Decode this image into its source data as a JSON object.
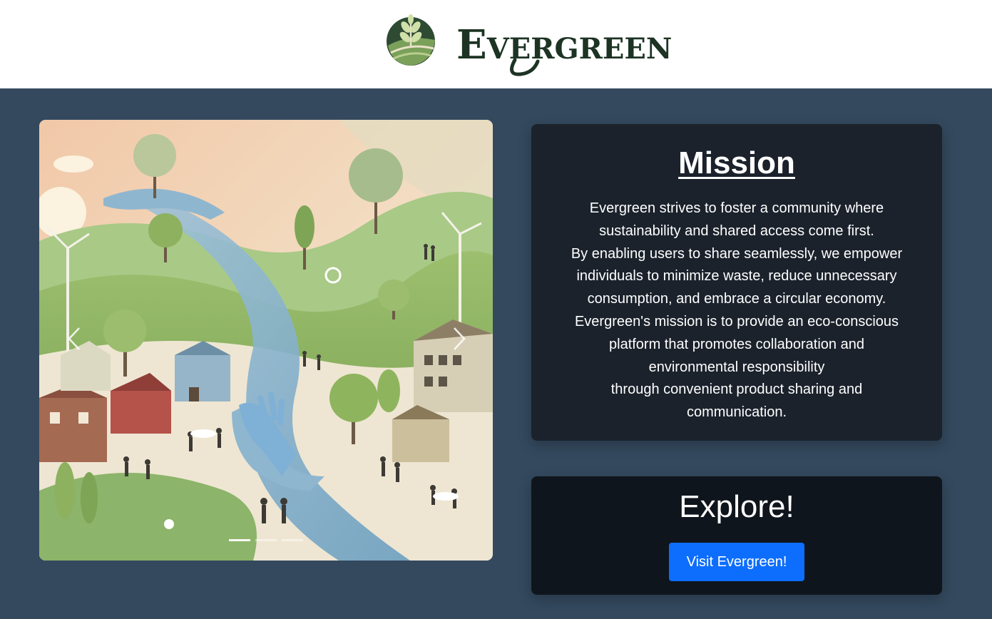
{
  "brand": {
    "name": "Evergreen",
    "logo_icon": "leaf-sprout-logo-icon",
    "color": "#1d3324"
  },
  "carousel": {
    "prev_icon": "chevron-left-icon",
    "next_icon": "chevron-right-icon",
    "slide_count": 3,
    "active_slide": 1
  },
  "mission": {
    "title": "Mission",
    "lines": [
      "Evergreen strives to foster a community where",
      "sustainability and shared access come first.",
      "By enabling users to share seamlessly, we empower",
      "individuals to minimize waste, reduce unnecessary",
      "consumption, and embrace a circular economy.",
      "Evergreen's mission is to provide an eco-conscious",
      "platform that promotes collaboration and",
      "environmental responsibility",
      "through convenient product sharing and",
      "communication."
    ]
  },
  "explore": {
    "title": "Explore!",
    "button_label": "Visit Evergreen!"
  },
  "colors": {
    "page_background": "#34495e",
    "mission_card": "#1b222c",
    "explore_card": "#0f151c",
    "primary_button": "#0d6efd"
  }
}
